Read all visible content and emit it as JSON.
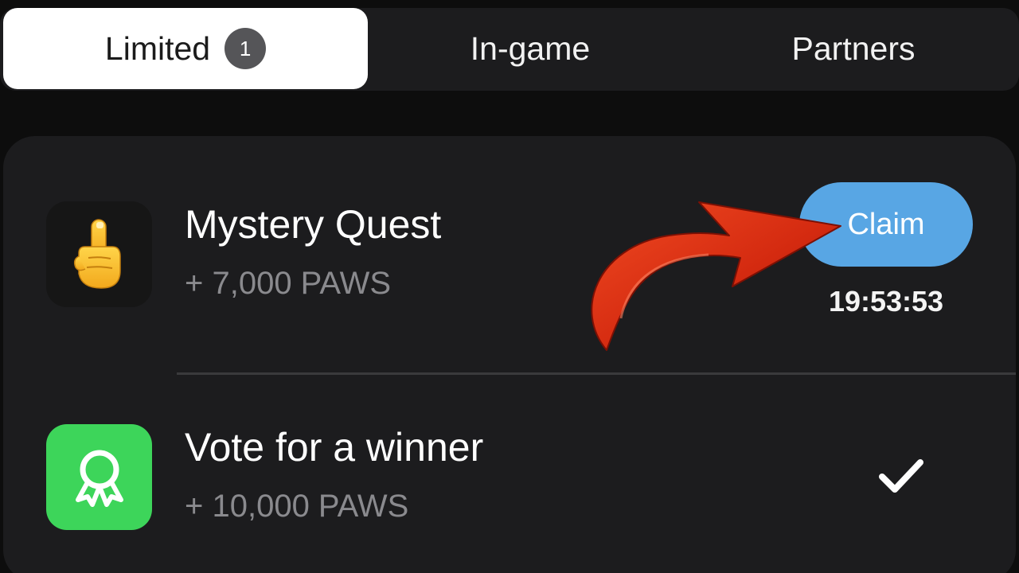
{
  "tabs": [
    {
      "label": "Limited",
      "badge": "1",
      "active": true
    },
    {
      "label": "In-game",
      "active": false
    },
    {
      "label": "Partners",
      "active": false
    }
  ],
  "tasks": [
    {
      "title": "Mystery Quest",
      "reward": "+ 7,000 PAWS",
      "icon": "pointing-up-hand-icon",
      "action_label": "Claim",
      "timer": "19:53:53",
      "status": "claimable"
    },
    {
      "title": "Vote for a winner",
      "reward": "+ 10,000 PAWS",
      "icon": "award-ribbon-icon",
      "status": "completed"
    }
  ],
  "colors": {
    "background": "#0d0d0d",
    "card": "#1c1c1e",
    "active_tab": "#ffffff",
    "claim_button": "#58a6e4",
    "green_icon_bg": "#3dd55a",
    "annotation_arrow": "#d42a10"
  },
  "annotation": "red-curved-arrow-icon"
}
